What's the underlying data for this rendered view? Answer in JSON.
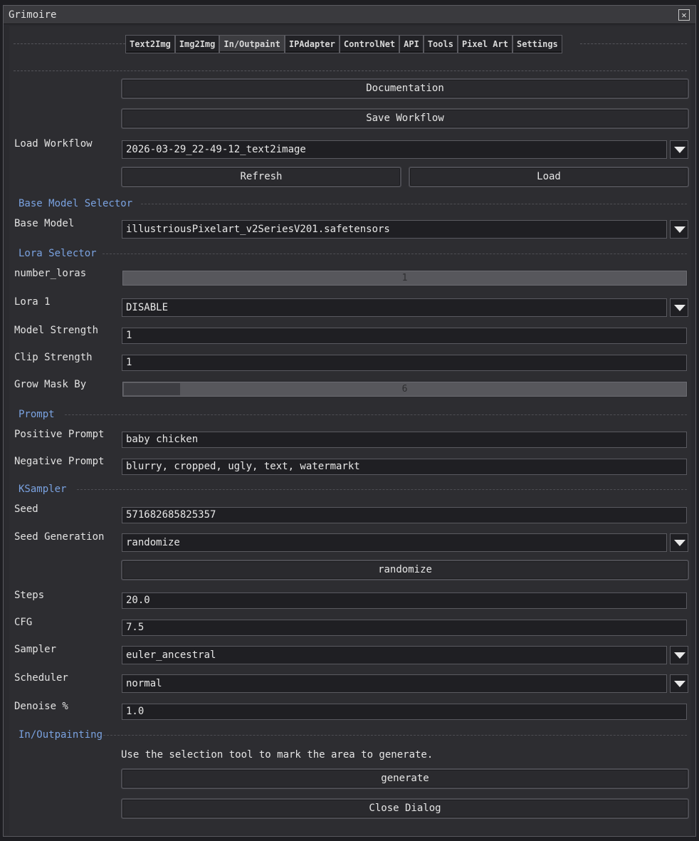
{
  "window": {
    "title": "Grimoire"
  },
  "tabs": [
    {
      "label": "Text2Img",
      "active": false
    },
    {
      "label": "Img2Img",
      "active": false
    },
    {
      "label": "In/Outpaint",
      "active": true
    },
    {
      "label": "IPAdapter",
      "active": false
    },
    {
      "label": "ControlNet",
      "active": false
    },
    {
      "label": "API",
      "active": false
    },
    {
      "label": "Tools",
      "active": false
    },
    {
      "label": "Pixel Art",
      "active": false
    },
    {
      "label": "Settings",
      "active": false
    }
  ],
  "buttons": {
    "documentation": "Documentation",
    "save_workflow": "Save Workflow",
    "refresh": "Refresh",
    "load": "Load",
    "randomize": "randomize",
    "generate": "generate",
    "close_dialog": "Close Dialog"
  },
  "workflow": {
    "label": "Load Workflow",
    "value": "2026-03-29_22-49-12_text2image"
  },
  "sections": {
    "base_model": "Base Model Selector",
    "lora": "Lora Selector",
    "prompt": "Prompt",
    "ksampler": "KSampler",
    "inoutpainting": "In/Outpainting"
  },
  "base_model": {
    "label": "Base Model",
    "value": "illustriousPixelart_v2SeriesV201.safetensors"
  },
  "lora": {
    "number_label": "number_loras",
    "number_value": "1",
    "lora1_label": "Lora 1",
    "lora1_value": "DISABLE",
    "model_strength_label": "Model Strength",
    "model_strength_value": "1",
    "clip_strength_label": "Clip Strength",
    "clip_strength_value": "1",
    "grow_mask_label": "Grow Mask By",
    "grow_mask_value": "6",
    "grow_mask_fraction": 0.1
  },
  "prompt": {
    "positive_label": "Positive Prompt",
    "positive_value": "baby chicken",
    "negative_label": "Negative Prompt",
    "negative_value": "blurry, cropped, ugly, text, watermarkt"
  },
  "ksampler": {
    "seed_label": "Seed",
    "seed_value": "571682685825357",
    "seed_gen_label": "Seed Generation",
    "seed_gen_value": "randomize",
    "steps_label": "Steps",
    "steps_value": "20.0",
    "cfg_label": "CFG",
    "cfg_value": "7.5",
    "sampler_label": "Sampler",
    "sampler_value": "euler_ancestral",
    "scheduler_label": "Scheduler",
    "scheduler_value": "normal",
    "denoise_label": "Denoise %",
    "denoise_value": "1.0"
  },
  "inoutpainting": {
    "instruction": "Use the selection tool to mark the area to generate."
  }
}
